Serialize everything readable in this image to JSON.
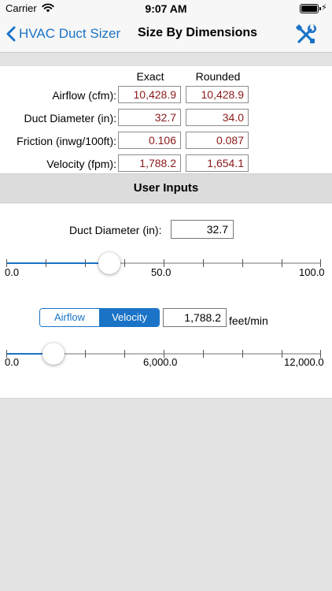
{
  "status_bar": {
    "carrier": "Carrier",
    "time": "9:07 AM"
  },
  "nav": {
    "back_label": "HVAC Duct Sizer",
    "title": "Size By Dimensions"
  },
  "results": {
    "col_exact": "Exact",
    "col_rounded": "Rounded",
    "rows": [
      {
        "label": "Airflow (cfm):",
        "exact": "10,428.9",
        "rounded": "10,428.9"
      },
      {
        "label": "Duct Diameter (in):",
        "exact": "32.7",
        "rounded": "34.0"
      },
      {
        "label": "Friction (inwg/100ft):",
        "exact": "0.106",
        "rounded": "0.087"
      },
      {
        "label": "Velocity (fpm):",
        "exact": "1,788.2",
        "rounded": "1,654.1"
      }
    ]
  },
  "section_header": "User Inputs",
  "diameter_input": {
    "label": "Duct Diameter (in):",
    "value": "32.7",
    "slider_min": "0.0",
    "slider_mid": "50.0",
    "slider_max": "100.0",
    "slider_fraction": 0.327
  },
  "velocity_input": {
    "seg_airflow": "Airflow",
    "seg_velocity": "Velocity",
    "value": "1,788.2",
    "unit": "feet/min",
    "slider_min": "0.0",
    "slider_mid": "6,000.0",
    "slider_max": "12,000.0",
    "slider_fraction": 0.149
  },
  "colors": {
    "accent": "#1a73c6",
    "value_text": "#8b1a1a"
  }
}
